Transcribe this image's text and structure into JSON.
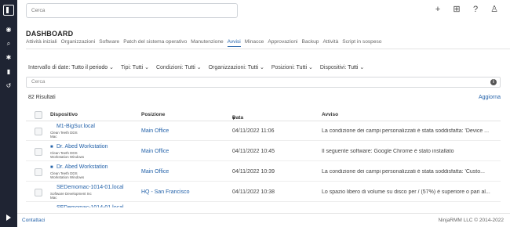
{
  "topbar": {
    "search_placeholder": "Cerca",
    "icons": [
      "plus-icon",
      "grid-icon",
      "help-icon",
      "user-icon"
    ]
  },
  "page_title": "DASHBOARD",
  "tabs": [
    {
      "label": "Attività iniziali",
      "active": false
    },
    {
      "label": "Organizzazioni",
      "active": false
    },
    {
      "label": "Software",
      "active": false
    },
    {
      "label": "Patch del sistema operativo",
      "active": false
    },
    {
      "label": "Manutenzione",
      "active": false
    },
    {
      "label": "Avvisi",
      "active": true
    },
    {
      "label": "Minacce",
      "active": false
    },
    {
      "label": "Approvazioni",
      "active": false
    },
    {
      "label": "Backup",
      "active": false
    },
    {
      "label": "Attività",
      "active": false
    },
    {
      "label": "Script in sospeso",
      "active": false
    }
  ],
  "filters": [
    {
      "label": "Intervallo di date:",
      "value": "Tutto il periodo"
    },
    {
      "label": "Tipi:",
      "value": "Tutti"
    },
    {
      "label": "Condizioni:",
      "value": "Tutti"
    },
    {
      "label": "Organizzazioni:",
      "value": "Tutti"
    },
    {
      "label": "Posizioni:",
      "value": "Tutti"
    },
    {
      "label": "Dispositivi:",
      "value": "Tutti"
    }
  ],
  "table_search_placeholder": "Cerca",
  "results": "82 Risultati",
  "refresh": "Aggiorna",
  "columns": {
    "device": "Dispositivo",
    "position": "Posizione",
    "date": "Data",
    "alert": "Avviso"
  },
  "rows": [
    {
      "device": "M1-BigSur.local",
      "device_icon": "apple-icon",
      "org": "Clean Teeth DDS",
      "type": "Mac",
      "position": "Main Office",
      "date": "04/11/2022 11:06",
      "alert": "La condizione dei campi personalizzati è stata soddisfatta: 'Device ..."
    },
    {
      "device": "Dr. Abed Workstation",
      "device_icon": "windows-icon",
      "org": "Clean Teeth DDS",
      "type": "Workstation Windows",
      "position": "Main Office",
      "date": "04/11/2022 10:45",
      "alert": "Il seguente software: Google Chrome è stato installato"
    },
    {
      "device": "Dr. Abed Workstation",
      "device_icon": "windows-icon",
      "org": "Clean Teeth DDS",
      "type": "Workstation Windows",
      "position": "Main Office",
      "date": "04/11/2022 10:39",
      "alert": "La condizione dei campi personalizzati è stata soddisfatta: 'Custo..."
    },
    {
      "device": "SEDemomac-1014-01.local",
      "device_icon": "apple-icon",
      "org": "Software Development Inc",
      "type": "Mac",
      "position": "HQ - San Francisco",
      "date": "04/11/2022 10:38",
      "alert": "Lo spazio libero di volume su disco per / (57%) è superiore o pari al..."
    },
    {
      "device": "SEDemomac-1014-01.local",
      "device_icon": "apple-icon",
      "org": "",
      "type": "",
      "position": "",
      "date": "",
      "alert": ""
    }
  ],
  "footer": {
    "contacts": "Contattaci",
    "copyright": "NinjaRMM LLC © 2014-2022"
  }
}
